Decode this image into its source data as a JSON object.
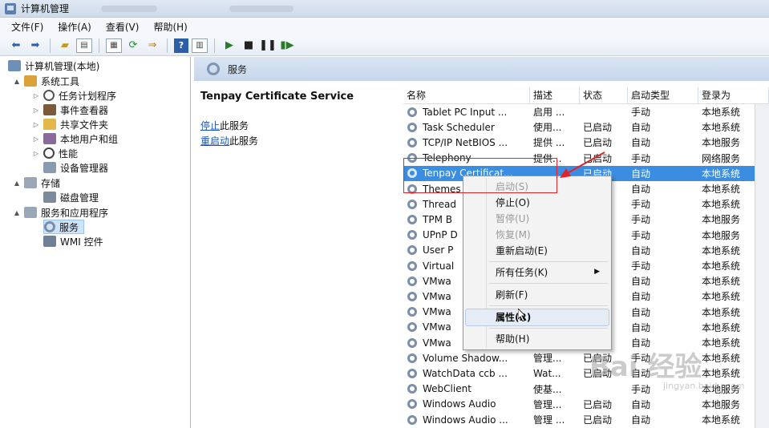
{
  "window": {
    "title": "计算机管理"
  },
  "menu": [
    "文件(F)",
    "操作(A)",
    "查看(V)",
    "帮助(H)"
  ],
  "tree": {
    "root": "计算机管理(本地)",
    "items": [
      {
        "label": "系统工具",
        "level": 1,
        "arrow": "▲"
      },
      {
        "label": "任务计划程序",
        "level": 2,
        "arrow": "▷"
      },
      {
        "label": "事件查看器",
        "level": 2,
        "arrow": "▷"
      },
      {
        "label": "共享文件夹",
        "level": 2,
        "arrow": "▷"
      },
      {
        "label": "本地用户和组",
        "level": 2,
        "arrow": "▷"
      },
      {
        "label": "性能",
        "level": 2,
        "arrow": "▷"
      },
      {
        "label": "设备管理器",
        "level": 2,
        "arrow": ""
      },
      {
        "label": "存储",
        "level": 1,
        "arrow": "▲"
      },
      {
        "label": "磁盘管理",
        "level": 2,
        "arrow": ""
      },
      {
        "label": "服务和应用程序",
        "level": 1,
        "arrow": "▲"
      },
      {
        "label": "服务",
        "level": 2,
        "arrow": ""
      },
      {
        "label": "WMI 控件",
        "level": 2,
        "arrow": ""
      }
    ]
  },
  "pane": {
    "title": "服务",
    "service_name": "Tenpay Certificate Service",
    "stop_link": "停止",
    "stop_suffix": "此服务",
    "restart_link": "重启动",
    "restart_suffix": "此服务"
  },
  "columns": [
    "名称",
    "描述",
    "状态",
    "启动类型",
    "登录为"
  ],
  "rows": [
    [
      "Tablet PC Input ...",
      "启用 ...",
      "",
      "手动",
      "本地系统"
    ],
    [
      "Task Scheduler",
      "使用...",
      "已启动",
      "自动",
      "本地系统"
    ],
    [
      "TCP/IP NetBIOS ...",
      "提供 ...",
      "已启动",
      "自动",
      "本地服务"
    ],
    [
      "Telephony",
      "提供...",
      "已启动",
      "手动",
      "网络服务"
    ],
    [
      "Tenpay Certificat...",
      "",
      "已启动",
      "自动",
      "本地系统"
    ],
    [
      "Themes",
      "",
      "",
      "自动",
      "本地系统"
    ],
    [
      "Thread",
      "",
      "",
      "手动",
      "本地系统"
    ],
    [
      "TPM B",
      "",
      "",
      "手动",
      "本地服务"
    ],
    [
      "UPnP D",
      "",
      "",
      "手动",
      "本地服务"
    ],
    [
      "User P",
      "",
      "",
      "自动",
      "本地系统"
    ],
    [
      "Virtual",
      "",
      "",
      "手动",
      "本地系统"
    ],
    [
      "VMwa",
      "",
      "",
      "自动",
      "本地系统"
    ],
    [
      "VMwa",
      "",
      "",
      "自动",
      "本地系统"
    ],
    [
      "VMwa",
      "",
      "",
      "自动",
      "本地系统"
    ],
    [
      "VMwa",
      "",
      "",
      "自动",
      "本地系统"
    ],
    [
      "VMwa",
      "",
      "",
      "自动",
      "本地系统"
    ],
    [
      "Volume Shadow...",
      "管理...",
      "已启动",
      "手动",
      "本地系统"
    ],
    [
      "WatchData ccb ...",
      "Wat...",
      "已启动",
      "自动",
      "本地系统"
    ],
    [
      "WebClient",
      "使基...",
      "",
      "手动",
      "本地服务"
    ],
    [
      "Windows Audio",
      "管理...",
      "已启动",
      "自动",
      "本地服务"
    ],
    [
      "Windows Audio ...",
      "管理 ...",
      "已启动",
      "自动",
      "本地系统"
    ]
  ],
  "selected_row": 4,
  "context_menu": [
    {
      "label": "启动(S)",
      "disabled": true
    },
    {
      "label": "停止(O)",
      "disabled": false
    },
    {
      "label": "暂停(U)",
      "disabled": true
    },
    {
      "label": "恢复(M)",
      "disabled": true
    },
    {
      "label": "重新启动(E)",
      "disabled": false
    },
    {
      "label": "所有任务(K)",
      "disabled": false
    },
    {
      "label": "刷新(F)",
      "disabled": false
    },
    {
      "label": "属性(R)",
      "disabled": false
    },
    {
      "label": "帮助(H)",
      "disabled": false
    }
  ],
  "watermark": {
    "text": "Bai 经验",
    "sub": "jingyan.baidu.com"
  },
  "colors": {
    "selection": "#3a8de0",
    "annotation": "#e0242a",
    "link": "#1b55b3"
  }
}
